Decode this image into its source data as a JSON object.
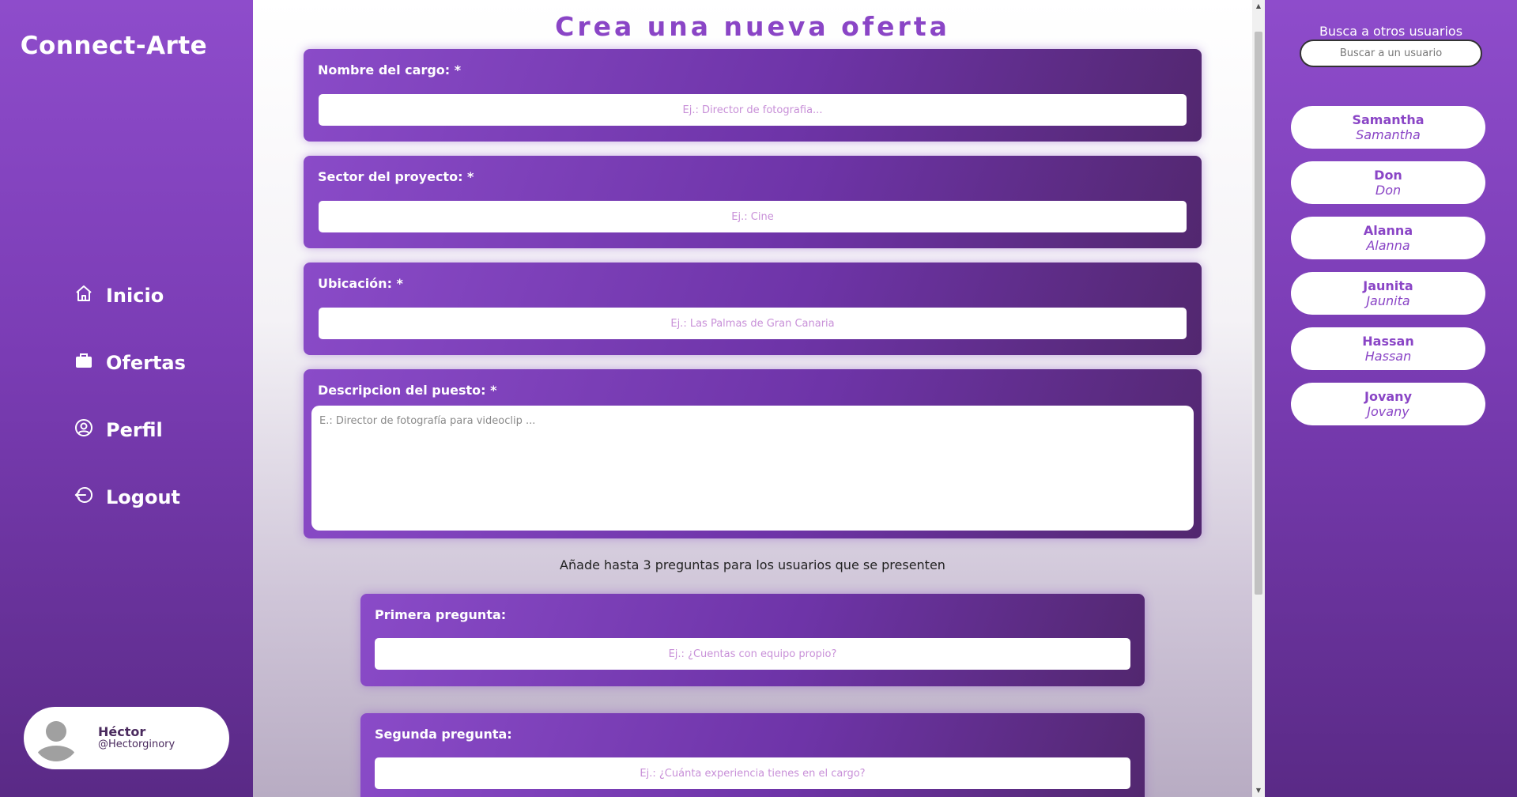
{
  "app": {
    "brand": "Connect-Arte"
  },
  "nav": [
    {
      "label": "Inicio",
      "icon": "home-icon"
    },
    {
      "label": "Ofertas",
      "icon": "briefcase-icon"
    },
    {
      "label": "Perfil",
      "icon": "user-circle-icon"
    },
    {
      "label": "Logout",
      "icon": "logout-icon"
    }
  ],
  "profile": {
    "name": "Héctor",
    "handle": "@Hectorginory"
  },
  "form": {
    "title": "Crea una nueva oferta",
    "fields": [
      {
        "label": "Nombre del cargo: *",
        "placeholder": "Ej.: Director de fotografia..."
      },
      {
        "label": "Sector del proyecto: *",
        "placeholder": "Ej.: Cine"
      },
      {
        "label": "Ubicación: *",
        "placeholder": "Ej.: Las Palmas de Gran Canaria"
      },
      {
        "label": "Descripcion del puesto: *",
        "placeholder": "E.: Director de fotografía para videoclip ..."
      }
    ],
    "questions_hint": "Añade hasta 3 preguntas para los usuarios que se presenten",
    "questions": [
      {
        "label": "Primera pregunta:",
        "placeholder": "Ej.: ¿Cuentas con equipo propio?"
      },
      {
        "label": "Segunda pregunta:",
        "placeholder": "Ej.: ¿Cuánta experiencia tienes en el cargo?"
      }
    ]
  },
  "search": {
    "title": "Busca a otros usuarios",
    "placeholder": "Buscar a un usuario"
  },
  "users": [
    {
      "name": "Samantha",
      "handle": "Samantha"
    },
    {
      "name": "Don",
      "handle": "Don"
    },
    {
      "name": "Alanna",
      "handle": "Alanna"
    },
    {
      "name": "Jaunita",
      "handle": "Jaunita"
    },
    {
      "name": "Hassan",
      "handle": "Hassan"
    },
    {
      "name": "Jovany",
      "handle": "Jovany"
    }
  ],
  "colors": {
    "accent": "#8a45c6",
    "sidebar_top": "#8e4ccb",
    "sidebar_bottom": "#5a2a86",
    "placeholder": "#c890d8"
  }
}
